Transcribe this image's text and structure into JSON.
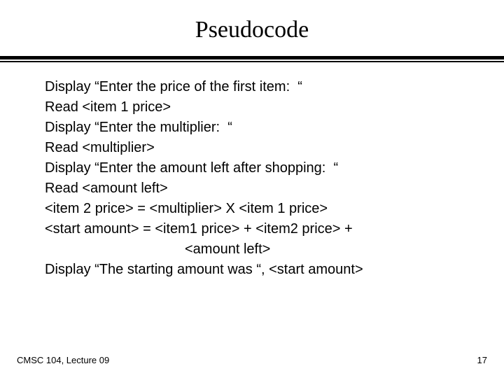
{
  "title": "Pseudocode",
  "lines": [
    "Display “Enter the price of the first item:  “",
    "Read <item 1 price>",
    "Display “Enter the multiplier:  “",
    "Read <multiplier>",
    "Display “Enter the amount left after shopping:  “",
    "Read <amount left>",
    "<item 2 price> = <multiplier> X <item 1 price>",
    "<start amount> = <item1 price> + <item2 price> +",
    "<amount left>",
    "Display “The starting amount was “, <start amount>"
  ],
  "footer": {
    "left": "CMSC 104, Lecture 09",
    "right": "17"
  }
}
